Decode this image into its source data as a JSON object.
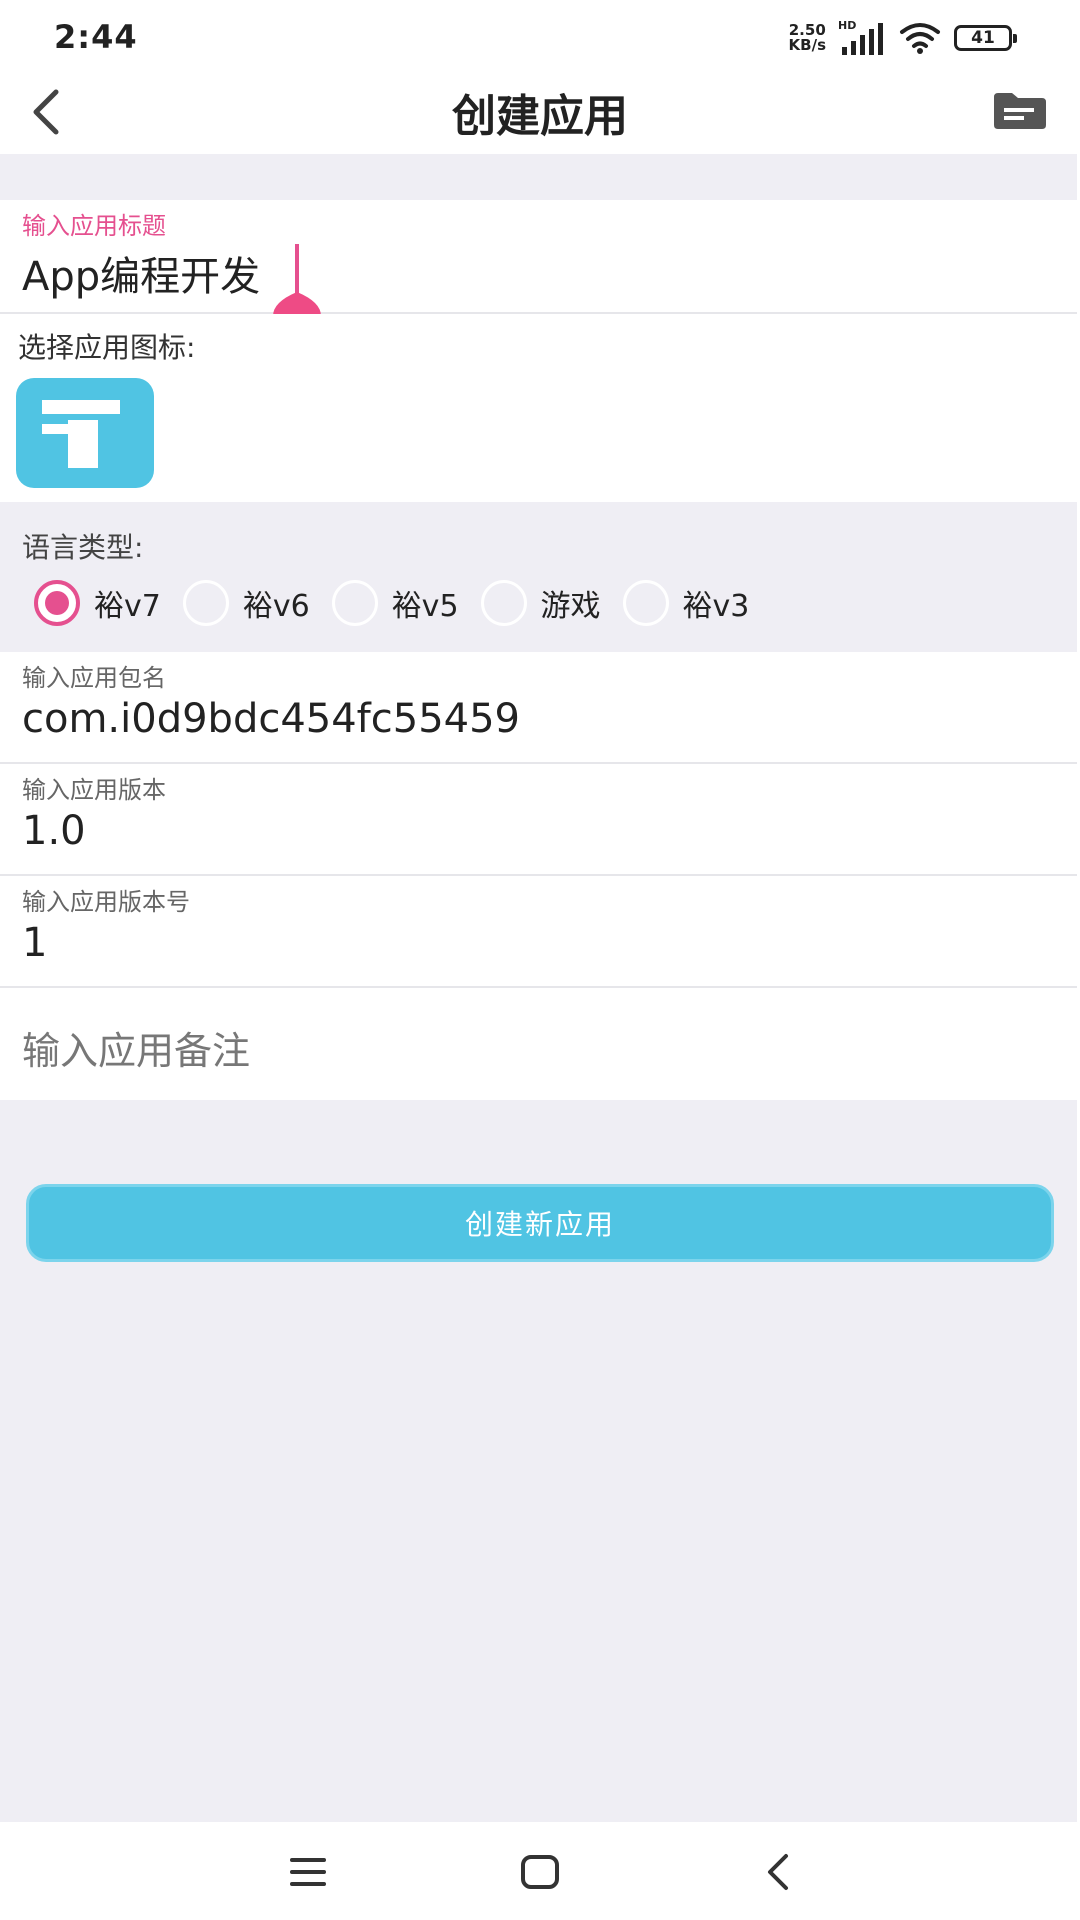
{
  "status_bar": {
    "time": "2:44",
    "net_speed_value": "2.50",
    "net_speed_unit": "KB/s",
    "signal_label": "HD",
    "battery": "41"
  },
  "header": {
    "title": "创建应用"
  },
  "form": {
    "title_field": {
      "label": "输入应用标题",
      "value": "App编程开发"
    },
    "icon_section": {
      "label": "选择应用图标:"
    },
    "language": {
      "label": "语言类型:",
      "options": [
        "裕v7",
        "裕v6",
        "裕v5",
        "游戏",
        "裕v3"
      ],
      "selected": "裕v7"
    },
    "package_field": {
      "label": "输入应用包名",
      "value": "com.i0d9bdc454fc55459"
    },
    "version_field": {
      "label": "输入应用版本",
      "value": "1.0"
    },
    "version_code_field": {
      "label": "输入应用版本号",
      "value": "1"
    },
    "note_field": {
      "placeholder": "输入应用备注"
    },
    "submit_label": "创建新应用"
  },
  "colors": {
    "accent_pink": "#e5508f",
    "accent_blue": "#50c4e3",
    "background": "#efeef4"
  },
  "icons": {
    "back": "chevron-left-icon",
    "folder": "folder-icon",
    "app_icon": "info-i-icon",
    "nav_menu": "menu-icon",
    "nav_home": "home-square-icon",
    "nav_back": "nav-back-icon"
  }
}
